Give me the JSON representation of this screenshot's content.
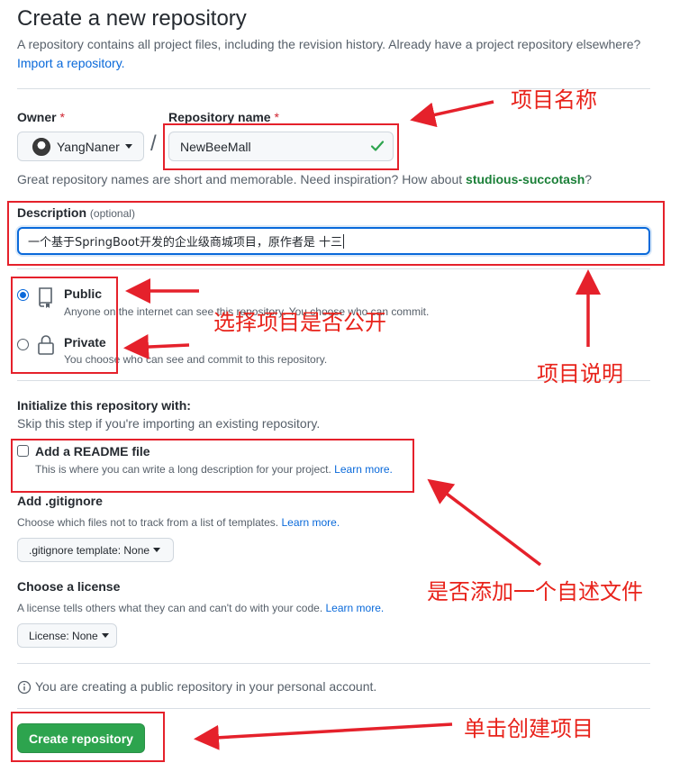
{
  "page": {
    "title": "Create a new repository",
    "subtitle": "A repository contains all project files, including the revision history. Already have a project repository elsewhere?",
    "import_link": "Import a repository."
  },
  "owner": {
    "label": "Owner",
    "required_mark": "*",
    "value": "YangNaner"
  },
  "separator": "/",
  "repo_name": {
    "label": "Repository name",
    "required_mark": "*",
    "value": "NewBeeMall"
  },
  "name_help": {
    "text": "Great repository names are short and memorable. Need inspiration? How about",
    "suggestion": "studious-succotash",
    "end": "?"
  },
  "description": {
    "label": "Description",
    "optional": "(optional)",
    "value": "一个基于SpringBoot开发的企业级商城项目，原作者是 十三"
  },
  "visibility": {
    "public": {
      "label": "Public",
      "desc": "Anyone on the internet can see this repository. You choose who can commit.",
      "selected": true
    },
    "private": {
      "label": "Private",
      "desc": "You choose who can see and commit to this repository.",
      "selected": false
    }
  },
  "init": {
    "heading": "Initialize this repository with:",
    "help": "Skip this step if you're importing an existing repository.",
    "readme_label": "Add a README file",
    "readme_desc": "This is where you can write a long description for your project.",
    "readme_link": "Learn more."
  },
  "gitignore": {
    "label": "Add .gitignore",
    "desc": "Choose which files not to track from a list of templates.",
    "link": "Learn more.",
    "button": ".gitignore template: None"
  },
  "license": {
    "label": "Choose a license",
    "desc": "A license tells others what they can and can't do with your code.",
    "link": "Learn more.",
    "button": "License: None"
  },
  "info_note": "You are creating a public repository in your personal account.",
  "create_button": "Create repository",
  "annotations": {
    "name": "项目名称",
    "visibility": "选择项目是否公开",
    "description": "项目说明",
    "readme": "是否添加一个自述文件",
    "create": "单击创建项目"
  },
  "colors": {
    "accent": "#0969da",
    "success": "#2da44e",
    "annotation": "#e5212b"
  }
}
